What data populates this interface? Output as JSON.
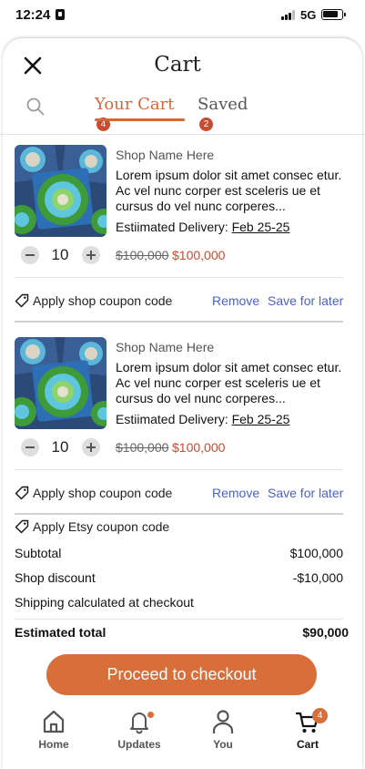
{
  "status_bar": {
    "time": "12:24",
    "network": "5G"
  },
  "sheet": {
    "title": "Cart"
  },
  "tabs": [
    {
      "label": "Your Cart",
      "badge": "4"
    },
    {
      "label": "Saved",
      "badge": "2"
    }
  ],
  "items": [
    {
      "shop": "Shop Name Here",
      "description": "Lorem ipsum dolor sit amet consec etur. Ac vel nunc corper est sceleris ue et cursus do vel nunc corperes...",
      "delivery_label": "Estiimated Delivery: ",
      "delivery_date": "Feb 25-25",
      "quantity": "10",
      "price_original": "$100,000",
      "price_sale": "$100,000",
      "coupon_label": "Apply shop coupon code",
      "remove_label": "Remove",
      "save_label": "Save for later"
    },
    {
      "shop": "Shop Name Here",
      "description": "Lorem ipsum dolor sit amet consec etur. Ac vel nunc corper est sceleris ue et cursus do vel nunc corperes...",
      "delivery_label": "Estiimated Delivery: ",
      "delivery_date": "Feb 25-25",
      "quantity": "10",
      "price_original": "$100,000",
      "price_sale": "$100,000",
      "coupon_label": "Apply shop coupon code",
      "remove_label": "Remove",
      "save_label": "Save for later"
    }
  ],
  "summary": {
    "etsy_coupon_label": "Apply Etsy coupon code",
    "subtotal_label": "Subtotal",
    "subtotal_value": "$100,000",
    "discount_label": "Shop discount",
    "discount_value": "-$10,000",
    "shipping_label": "Shipping calculated at checkout",
    "total_label": "Estimated total",
    "total_value": "$90,000"
  },
  "checkout_label": "Proceed to checkout",
  "nav": [
    {
      "label": "Home",
      "icon": "home-icon"
    },
    {
      "label": "Updates",
      "icon": "bell-icon"
    },
    {
      "label": "You",
      "icon": "person-icon"
    },
    {
      "label": "Cart",
      "icon": "cart-icon",
      "badge": "4"
    }
  ],
  "colors": {
    "accent": "#d86f3b",
    "badge": "#c94b30",
    "link": "#4a62c9"
  }
}
